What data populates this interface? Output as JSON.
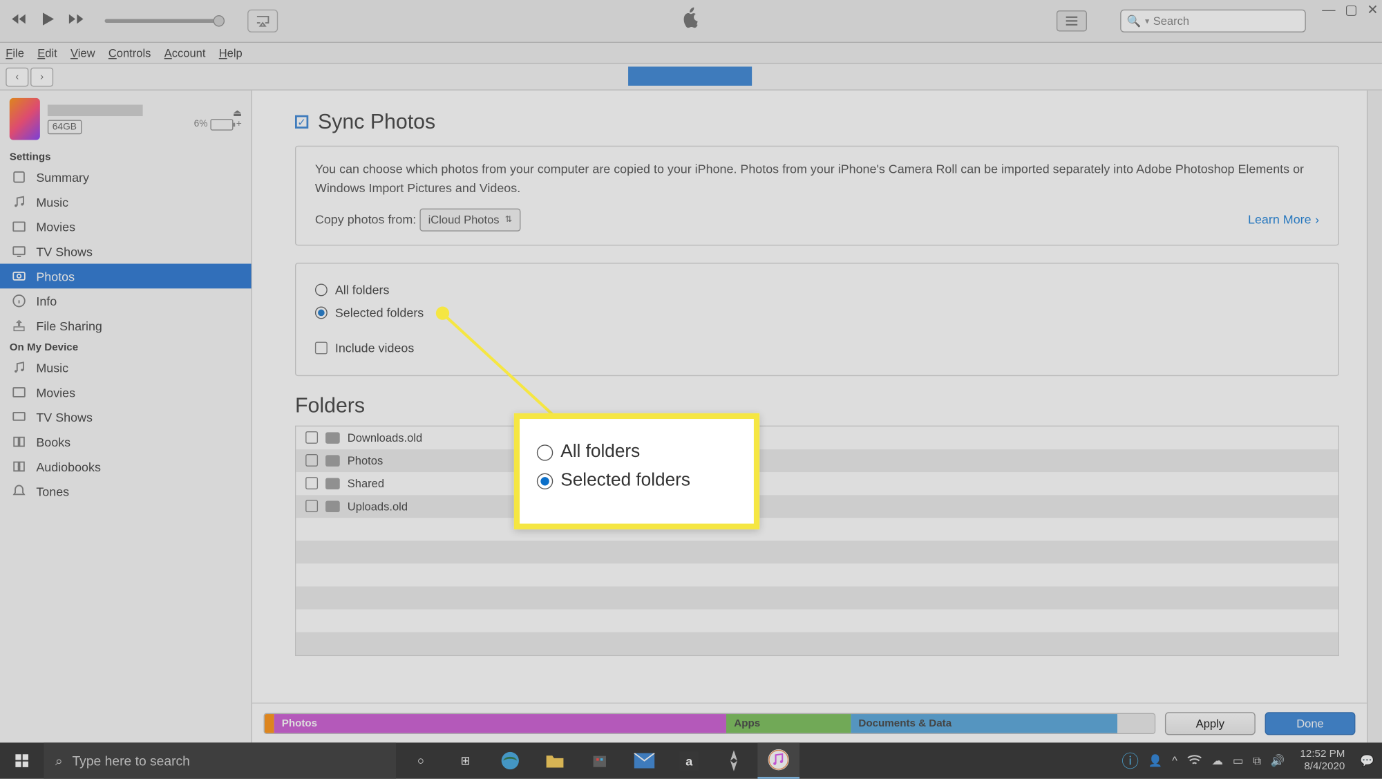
{
  "topbar": {
    "search_placeholder": "Search"
  },
  "menubar": {
    "file": "File",
    "edit": "Edit",
    "view": "View",
    "controls": "Controls",
    "account": "Account",
    "help": "Help"
  },
  "device": {
    "storage": "64GB",
    "battery_pct": "6%"
  },
  "sidebar": {
    "settings_header": "Settings",
    "settings": [
      {
        "label": "Summary",
        "icon": "summary"
      },
      {
        "label": "Music",
        "icon": "music"
      },
      {
        "label": "Movies",
        "icon": "movies"
      },
      {
        "label": "TV Shows",
        "icon": "tv"
      },
      {
        "label": "Photos",
        "icon": "photos"
      },
      {
        "label": "Info",
        "icon": "info"
      },
      {
        "label": "File Sharing",
        "icon": "fileshare"
      }
    ],
    "ondevice_header": "On My Device",
    "ondevice": [
      {
        "label": "Music",
        "icon": "music"
      },
      {
        "label": "Movies",
        "icon": "movies"
      },
      {
        "label": "TV Shows",
        "icon": "tv"
      },
      {
        "label": "Books",
        "icon": "books"
      },
      {
        "label": "Audiobooks",
        "icon": "audiobooks"
      },
      {
        "label": "Tones",
        "icon": "tones"
      }
    ]
  },
  "content": {
    "sync_title": "Sync Photos",
    "description": "You can choose which photos from your computer are copied to your iPhone. Photos from your iPhone's Camera Roll can be imported separately into Adobe Photoshop Elements or Windows Import Pictures and Videos.",
    "copy_from_label": "Copy photos from:",
    "copy_from_value": "iCloud Photos",
    "learn_more": "Learn More",
    "radio_all": "All folders",
    "radio_selected": "Selected folders",
    "include_videos": "Include videos",
    "folders_title": "Folders",
    "folders": [
      "Downloads.old",
      "Photos",
      "Shared",
      "Uploads.old"
    ],
    "storage_segments": {
      "photos": "Photos",
      "apps": "Apps",
      "docs": "Documents & Data"
    },
    "apply": "Apply",
    "done": "Done"
  },
  "callout": {
    "all": "All folders",
    "selected": "Selected folders"
  },
  "taskbar": {
    "search_placeholder": "Type here to search",
    "time": "12:52 PM",
    "date": "8/4/2020"
  }
}
